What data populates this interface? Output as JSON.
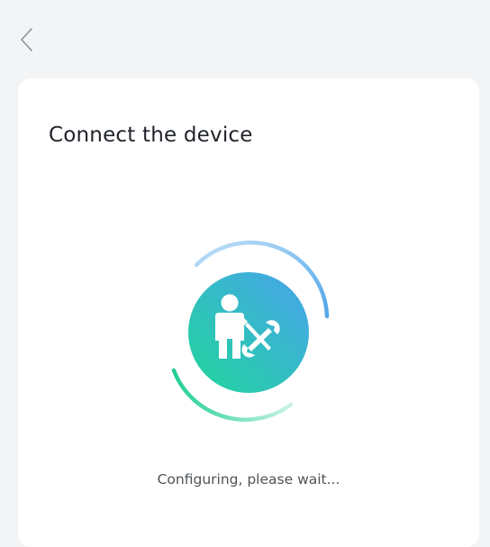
{
  "header": {
    "back_icon": "chevron-left-icon"
  },
  "card": {
    "title": "Connect the device",
    "illustration_icon": "technician-with-wrench-and-screwdriver-icon",
    "status_text": "Configuring, please wait..."
  },
  "colors": {
    "background": "#f3f4f6",
    "card": "#ffffff",
    "gradient_teal": "#1fd69a",
    "gradient_blue": "#49a3ee",
    "arc_blue": "#4fa6ea",
    "arc_green": "#22cf93"
  }
}
